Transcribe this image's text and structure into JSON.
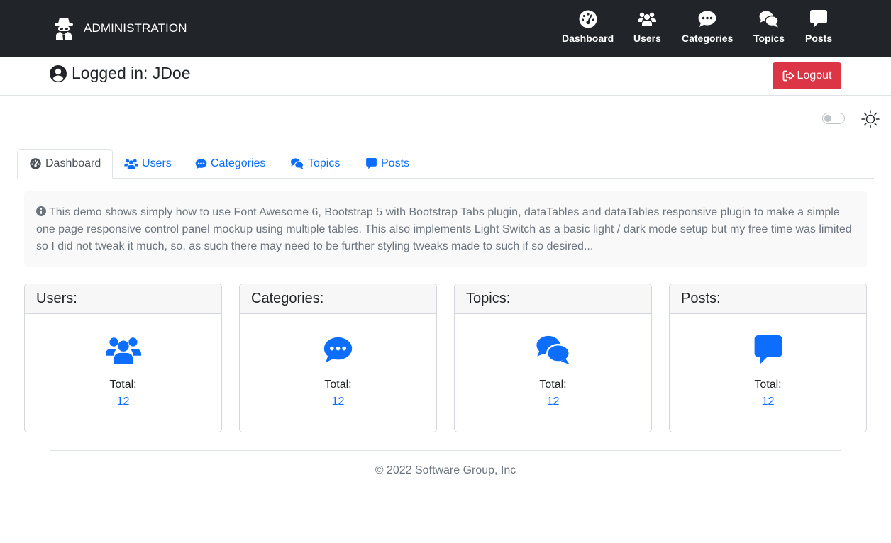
{
  "navbar": {
    "brand": {
      "icon": "user-secret-icon",
      "text": "ADMINISTRATION"
    },
    "items": [
      {
        "label": "Dashboard",
        "icon": "gauge-icon"
      },
      {
        "label": "Users",
        "icon": "users-icon"
      },
      {
        "label": "Categories",
        "icon": "comment-dots-icon"
      },
      {
        "label": "Topics",
        "icon": "comments-icon"
      },
      {
        "label": "Posts",
        "icon": "message-icon"
      }
    ]
  },
  "login": {
    "text": "Logged in: JDoe",
    "icon": "user-circle-icon",
    "logout_label": "Logout",
    "logout_icon": "sign-out-icon"
  },
  "theme": {
    "switch_on": false,
    "icon": "sun-icon"
  },
  "tabs": [
    {
      "label": "Dashboard",
      "icon": "gauge-icon",
      "active": true
    },
    {
      "label": "Users",
      "icon": "users-icon",
      "active": false
    },
    {
      "label": "Categories",
      "icon": "comment-dots-icon",
      "active": false
    },
    {
      "label": "Topics",
      "icon": "comments-icon",
      "active": false
    },
    {
      "label": "Posts",
      "icon": "message-icon",
      "active": false
    }
  ],
  "info": {
    "icon": "info-circle-icon",
    "text": "This demo shows simply how to use Font Awesome 6, Bootstrap 5 with Bootstrap Tabs plugin, dataTables and dataTables responsive plugin to make a simple one page responsive control panel mockup using multiple tables. This also implements Light Switch as a basic light / dark mode setup but my free time was limited so I did not tweak it much, so, as such there may need to be further styling tweaks made to such if so desired..."
  },
  "cards": [
    {
      "title": "Users:",
      "icon": "users-icon",
      "total_label": "Total:",
      "total_value": "12"
    },
    {
      "title": "Categories:",
      "icon": "comment-dots-icon",
      "total_label": "Total:",
      "total_value": "12"
    },
    {
      "title": "Topics:",
      "icon": "comments-icon",
      "total_label": "Total:",
      "total_value": "12"
    },
    {
      "title": "Posts:",
      "icon": "message-icon",
      "total_label": "Total:",
      "total_value": "12"
    }
  ],
  "footer": {
    "text": "© 2022 Software Group, Inc"
  },
  "colors": {
    "navbar_bg": "#212529",
    "primary": "#0d6efd",
    "danger": "#dc3545",
    "muted": "#6c757d"
  }
}
